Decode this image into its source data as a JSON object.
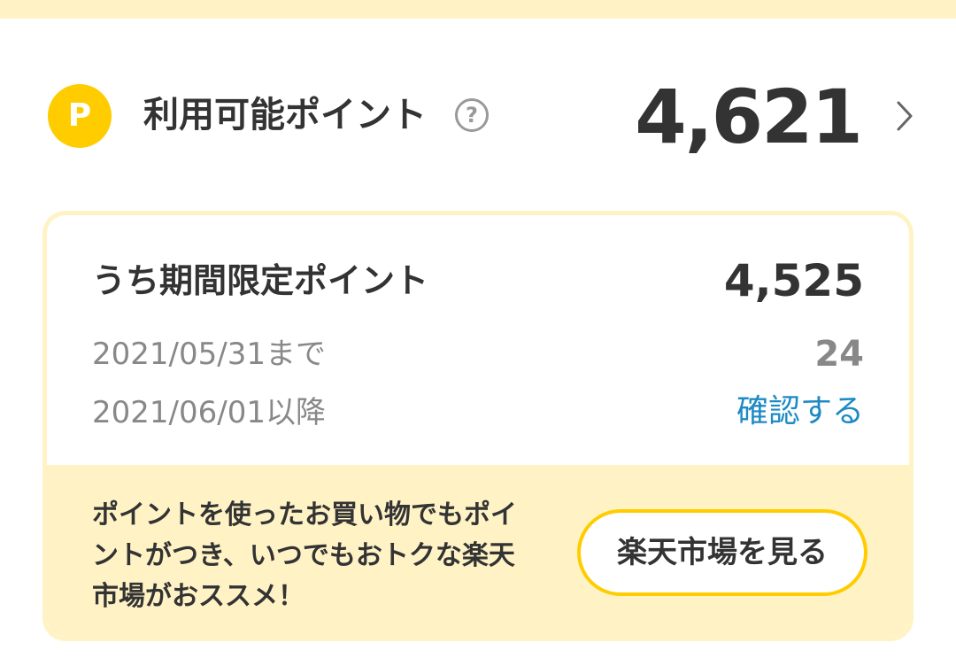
{
  "points": {
    "badge_letter": "P",
    "label": "利用可能ポイント",
    "help_icon": "question-circle-icon",
    "value": "4,621",
    "chevron_icon": "chevron-right-icon"
  },
  "limited": {
    "title": "うち期間限定ポイント",
    "total": "4,525",
    "rows": [
      {
        "label": "2021/05/31まで",
        "value": "24"
      },
      {
        "label": "2021/06/01以降",
        "link": "確認する"
      }
    ]
  },
  "promo": {
    "text": "ポイントを使ったお買い物でもポイントがつき、いつでもおトクな楽天市場がおススメ！",
    "button": "楽天市場を見る"
  },
  "colors": {
    "accent_yellow": "#ffcc00",
    "pale_yellow": "#fff3c6",
    "text_dark": "#333333",
    "text_gray": "#888888",
    "link_blue": "#1d8ac4"
  }
}
